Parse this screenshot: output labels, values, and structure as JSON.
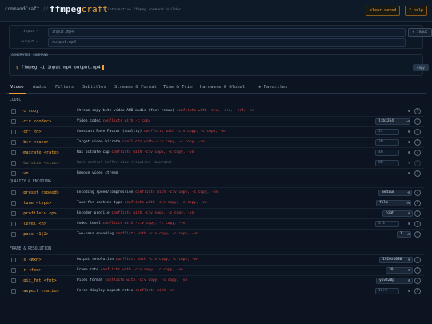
{
  "header": {
    "brand": "commandCraft",
    "separator": "//",
    "logo_main": "ffmpeg",
    "logo_accent": "craft",
    "tagline": "// interactive ffmpeg command builder",
    "clear_label": "clear saved",
    "help_label": "? help"
  },
  "io": {
    "input_label": "input →",
    "input_placeholder": "input.mp4",
    "add_input_label": "+ input",
    "output_label": "output →",
    "output_placeholder": "output.mp4"
  },
  "generated": {
    "label": "GENERATED COMMAND",
    "prompt": "$",
    "command": "ffmpeg -i input.mp4 output.mp4",
    "copy_label": "copy"
  },
  "tabs": [
    "Video",
    "Audio",
    "Filters",
    "Subtitles",
    "Streams & Format",
    "Time & Trim",
    "Hardware & Global",
    "★ Favorites"
  ],
  "sections": [
    {
      "title": "CODEC",
      "rows": [
        {
          "flag": "-c copy",
          "desc": "Stream copy both video AND audio (fast remux)",
          "conflict": "conflicts with -c:v, -c:a, -crf, -vn",
          "control": "none",
          "dim": false
        },
        {
          "flag": "-c:v <codec>",
          "desc": "Video codec",
          "conflict": "conflicts with -c copy",
          "control": "select",
          "value": "libx264",
          "dim": false
        },
        {
          "flag": "-crf <n>",
          "desc": "Constant Rate Factor (quality)",
          "conflict": "conflicts with -c:v copy, -c copy, -vn",
          "control": "input",
          "value": "23",
          "dim": false
        },
        {
          "flag": "-b:v <rate>",
          "desc": "Target video bitrate",
          "conflict": "conflicts with -c:v copy, -c copy, -vn",
          "control": "input",
          "value": "2M",
          "dim": false
        },
        {
          "flag": "-maxrate <rate>",
          "desc": "Max bitrate cap",
          "conflict": "conflicts with -c:v copy, -c copy, -vn",
          "control": "input",
          "value": "4M",
          "dim": false
        },
        {
          "flag": "-bufsize <size>",
          "desc": "Rate control buffer size (requires -maxrate)",
          "conflict": "",
          "control": "input",
          "value": "8M",
          "dim": true
        },
        {
          "flag": "-vn",
          "desc": "Remove video stream",
          "conflict": "",
          "control": "none",
          "dim": false
        }
      ]
    },
    {
      "title": "QUALITY & ENCODING",
      "rows": [
        {
          "flag": "-preset <speed>",
          "desc": "Encoding speed/compression",
          "conflict": "conflicts with -c:v copy, -c copy, -vn",
          "control": "select",
          "value": "medium",
          "dim": false
        },
        {
          "flag": "-tune <type>",
          "desc": "Tune for content type",
          "conflict": "conflicts with -c:v copy, -c copy, -vn",
          "control": "select",
          "value": "film",
          "dim": false
        },
        {
          "flag": "-profile:v <p>",
          "desc": "Encoder profile",
          "conflict": "conflicts with -c:v copy, -c copy, -vn",
          "control": "select",
          "value": "high",
          "dim": false
        },
        {
          "flag": "-level <n>",
          "desc": "Codec level",
          "conflict": "conflicts with -c:v copy, -c copy, -vn",
          "control": "input",
          "value": "4.1",
          "dim": false
        },
        {
          "flag": "-pass <1|2>",
          "desc": "Two-pass encoding",
          "conflict": "conflicts with -c:v copy, -c copy, -vn",
          "control": "select",
          "value": "1",
          "dim": false
        }
      ]
    },
    {
      "title": "FRAME & RESOLUTION",
      "rows": [
        {
          "flag": "-s <WxH>",
          "desc": "Output resolution",
          "conflict": "conflicts with -c:v copy, -c copy, -vn",
          "control": "select",
          "value": "1920x1080",
          "dim": false
        },
        {
          "flag": "-r <fps>",
          "desc": "Frame rate",
          "conflict": "conflicts with -c:v copy, -c copy, -vn",
          "control": "select",
          "value": "30",
          "dim": false
        },
        {
          "flag": "-pix_fmt <fmt>",
          "desc": "Pixel format",
          "conflict": "conflicts with -c:v copy, -c copy, -vn",
          "control": "select",
          "value": "yuv420p",
          "dim": false
        },
        {
          "flag": "-aspect <ratio>",
          "desc": "Force display aspect ratio",
          "conflict": "conflicts with -vn",
          "control": "input",
          "value": "16:9",
          "dim": false
        }
      ]
    }
  ]
}
